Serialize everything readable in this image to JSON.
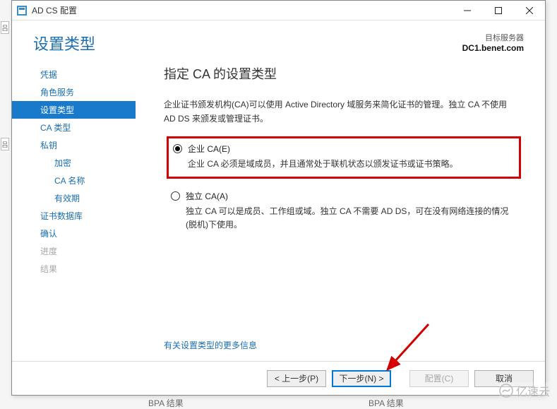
{
  "titlebar": {
    "title": "AD CS 配置"
  },
  "header": {
    "page_title": "设置类型",
    "target_label": "目标服务器",
    "target_server": "DC1.benet.com"
  },
  "sidebar": {
    "items": [
      {
        "label": "凭据",
        "state": "normal"
      },
      {
        "label": "角色服务",
        "state": "normal"
      },
      {
        "label": "设置类型",
        "state": "active"
      },
      {
        "label": "CA 类型",
        "state": "normal"
      },
      {
        "label": "私钥",
        "state": "normal"
      },
      {
        "label": "加密",
        "state": "sub"
      },
      {
        "label": "CA 名称",
        "state": "sub"
      },
      {
        "label": "有效期",
        "state": "sub"
      },
      {
        "label": "证书数据库",
        "state": "normal"
      },
      {
        "label": "确认",
        "state": "normal"
      },
      {
        "label": "进度",
        "state": "disabled"
      },
      {
        "label": "结果",
        "state": "disabled"
      }
    ]
  },
  "main": {
    "title": "指定 CA 的设置类型",
    "description": "企业证书颁发机构(CA)可以使用 Active Directory 域服务来简化证书的管理。独立 CA 不使用 AD DS 来颁发或管理证书。",
    "options": [
      {
        "label": "企业 CA(E)",
        "desc": "企业 CA 必须是域成员，并且通常处于联机状态以颁发证书或证书策略。",
        "checked": true,
        "highlight": true
      },
      {
        "label": "独立 CA(A)",
        "desc": "独立 CA 可以是成员、工作组或域。独立 CA 不需要 AD DS，可在没有网络连接的情况(脱机)下使用。",
        "checked": false,
        "highlight": false
      }
    ],
    "more_info_link": "有关设置类型的更多信息"
  },
  "footer": {
    "prev": "< 上一步(P)",
    "next": "下一步(N) >",
    "configure": "配置(C)",
    "cancel": "取消"
  },
  "extras": {
    "bpa_label": "BPA 结果",
    "watermark": "亿速云"
  }
}
